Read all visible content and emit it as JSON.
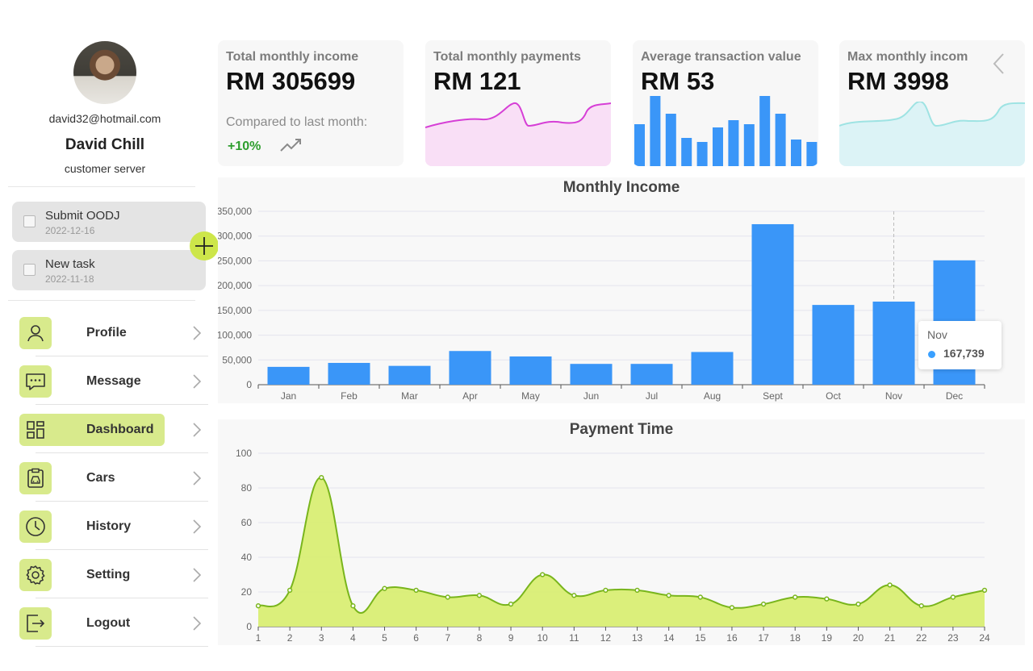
{
  "profile": {
    "email": "david32@hotmail.com",
    "name": "David Chill",
    "role": "customer server"
  },
  "tasks": [
    {
      "title": "Submit OODJ",
      "date": "2022-12-16"
    },
    {
      "title": "New task",
      "date": "2022-11-18"
    }
  ],
  "nav": [
    {
      "label": "Profile",
      "icon": "user-icon"
    },
    {
      "label": "Message",
      "icon": "message-icon"
    },
    {
      "label": "Dashboard",
      "icon": "dashboard-icon",
      "active": true
    },
    {
      "label": "Cars",
      "icon": "car-icon"
    },
    {
      "label": "History",
      "icon": "clock-icon"
    },
    {
      "label": "Setting",
      "icon": "gear-icon"
    },
    {
      "label": "Logout",
      "icon": "logout-icon"
    }
  ],
  "cards": [
    {
      "title": "Total monthly income",
      "value": "RM 305699",
      "compare_label": "Compared to last month:",
      "change": "+10%",
      "change_color": "#2e9e2e"
    },
    {
      "title": "Total monthly payments",
      "value": "RM 121",
      "spark_color": "#d63fd6",
      "fill_color": "#f9dff6"
    },
    {
      "title": "Average transaction value",
      "value": "RM 53",
      "bar_color": "#3a96f8"
    },
    {
      "title": "Max monthly incom",
      "value": "RM 3998",
      "spark_color": "#9ee3e3",
      "fill_color": "#dcf3f6"
    }
  ],
  "colors": {
    "accent": "#d8ea8c",
    "accent_strong": "#cde64a",
    "bar": "#3a96f8",
    "area_fill": "#d9ee74",
    "area_line": "#79b51c"
  },
  "chart_data": [
    {
      "type": "bar",
      "title": "Monthly Income",
      "categories": [
        "Jan",
        "Feb",
        "Mar",
        "Apr",
        "May",
        "Jun",
        "Jul",
        "Aug",
        "Sept",
        "Oct",
        "Nov",
        "Dec"
      ],
      "values": [
        36000,
        44000,
        38000,
        68000,
        57000,
        42000,
        42000,
        66000,
        324000,
        161000,
        167739,
        251000
      ],
      "ylim": [
        0,
        350000
      ],
      "yticks": [
        "0",
        "50,000",
        "100,000",
        "150,000",
        "200,000",
        "250,000",
        "300,000",
        "350,000"
      ],
      "grid": true,
      "tooltip": {
        "category": "Nov",
        "value": "167,739"
      }
    },
    {
      "type": "area",
      "title": "Payment Time",
      "x": [
        1,
        2,
        3,
        4,
        5,
        6,
        7,
        8,
        9,
        10,
        11,
        12,
        13,
        14,
        15,
        16,
        17,
        18,
        19,
        20,
        21,
        22,
        23,
        24
      ],
      "values": [
        12,
        21,
        86,
        12,
        22,
        21,
        17,
        18,
        13,
        30,
        18,
        21,
        21,
        18,
        17,
        11,
        13,
        17,
        16,
        13,
        24,
        12,
        17,
        21
      ],
      "ylim": [
        0,
        100
      ],
      "yticks": [
        "0",
        "20",
        "40",
        "60",
        "80",
        "100"
      ],
      "grid": true
    }
  ],
  "mini_bars": [
    52,
    87,
    65,
    35,
    30,
    48,
    57,
    52,
    87,
    65,
    33,
    30
  ]
}
